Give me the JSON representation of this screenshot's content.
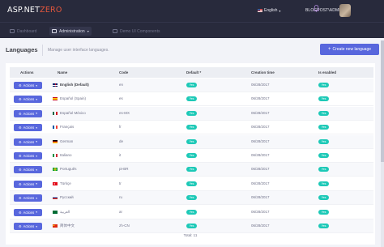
{
  "brand": {
    "logo_main": "ASP.NET",
    "logo_accent": "ZERO"
  },
  "topbar": {
    "language": "English",
    "user": "BLOGPOST\\ADMIN",
    "bell_icon": "bell-icon"
  },
  "nav": {
    "items": [
      {
        "label": "Dashboard",
        "icon": "dashboard-icon"
      },
      {
        "label": "Administration",
        "icon": "admin-icon"
      },
      {
        "label": "Demo UI Components",
        "icon": "components-icon"
      }
    ]
  },
  "page": {
    "title": "Languages",
    "description": "Manage user interface languages.",
    "create_button": "Create new language"
  },
  "table": {
    "columns": [
      "Actions",
      "Name",
      "Code",
      "Default *",
      "Creation time",
      "Is enabled"
    ],
    "action_label": "Actions",
    "rows": [
      {
        "name": "English (Default)",
        "code": "en",
        "default": "Yes",
        "created": "06/28/2017",
        "enabled": "Yes",
        "flag": "gb"
      },
      {
        "name": "Español (Spain)",
        "code": "es",
        "default": "Yes",
        "created": "06/28/2017",
        "enabled": "Yes",
        "flag": "es"
      },
      {
        "name": "Español México",
        "code": "es-MX",
        "default": "Yes",
        "created": "06/28/2017",
        "enabled": "Yes",
        "flag": "mx"
      },
      {
        "name": "Français",
        "code": "fr",
        "default": "Yes",
        "created": "06/28/2017",
        "enabled": "Yes",
        "flag": "fr"
      },
      {
        "name": "German",
        "code": "de",
        "default": "Yes",
        "created": "06/28/2017",
        "enabled": "Yes",
        "flag": "de"
      },
      {
        "name": "Italiano",
        "code": "it",
        "default": "Yes",
        "created": "06/28/2017",
        "enabled": "Yes",
        "flag": "it"
      },
      {
        "name": "Português",
        "code": "pt-BR",
        "default": "Yes",
        "created": "06/28/2017",
        "enabled": "Yes",
        "flag": "br"
      },
      {
        "name": "Türkçe",
        "code": "tr",
        "default": "Yes",
        "created": "06/28/2017",
        "enabled": "Yes",
        "flag": "tr"
      },
      {
        "name": "Pусский",
        "code": "ru",
        "default": "Yes",
        "created": "06/28/2017",
        "enabled": "Yes",
        "flag": "ru"
      },
      {
        "name": "العربية",
        "code": "ar",
        "default": "Yes",
        "created": "06/28/2017",
        "enabled": "Yes",
        "flag": "sa"
      },
      {
        "name": "简体中文",
        "code": "zh-CN",
        "default": "Yes",
        "created": "06/28/2017",
        "enabled": "Yes",
        "flag": "cn"
      }
    ],
    "total": "Total: 11"
  },
  "colors": {
    "accent": "#5867dd",
    "badge": "#1dc9b7",
    "header_bg": "#282a3c"
  }
}
